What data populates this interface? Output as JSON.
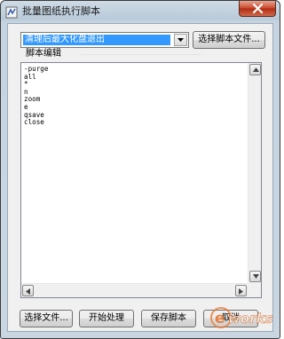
{
  "window": {
    "title": "批量图纸执行脚本",
    "icons": {
      "app": "script-app-icon",
      "close": "close-icon"
    }
  },
  "script_select": {
    "selected": "清理后最大化盘退出",
    "dropdown_icon": "chevron-down-icon",
    "select_file_button": "选择脚本文件..."
  },
  "editor": {
    "label": "脚本编辑",
    "lines": [
      "-purge",
      "all",
      "*",
      "n",
      "zoom",
      "e",
      "qsave",
      "close"
    ]
  },
  "footer": {
    "select_files_button": "选择文件...",
    "start_button": "开始处理",
    "save_script_button": "保存脚本",
    "cancel_button": "取消"
  },
  "watermark": {
    "text": "e works"
  },
  "colors": {
    "selection": "#3399ff",
    "close_button": "#c7452b",
    "watermark": "#e8742a"
  }
}
